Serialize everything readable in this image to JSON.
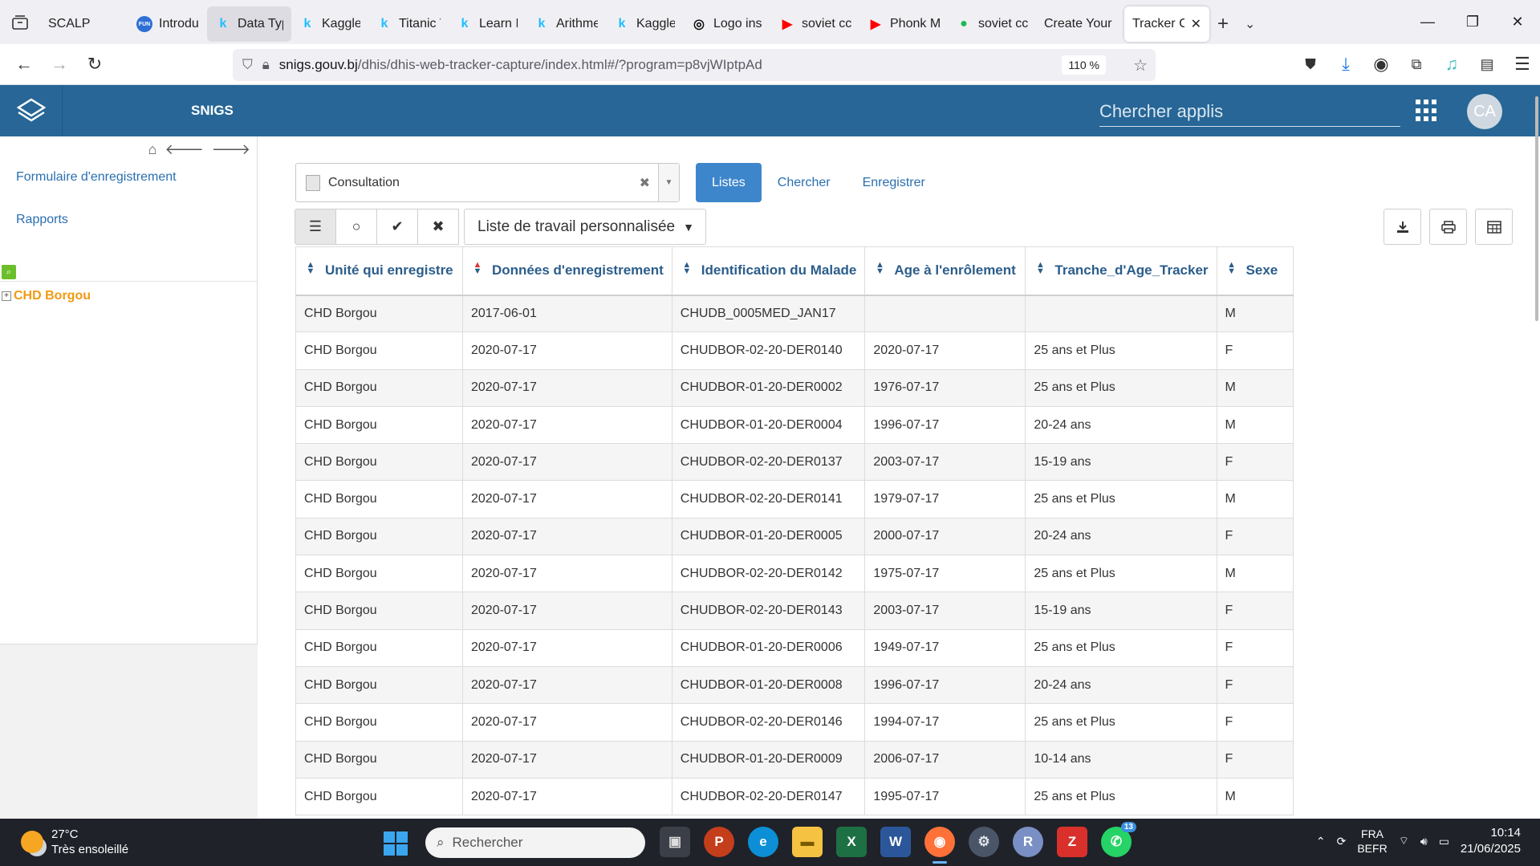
{
  "browser": {
    "tabs": [
      {
        "title": "SCALP",
        "fav": "",
        "favColor": "#888"
      },
      {
        "title": "Introduc",
        "fav": "FUN",
        "favColor": "#2e6fd6"
      },
      {
        "title": "Data Typ",
        "fav": "k",
        "favColor": "#20beff"
      },
      {
        "title": "Kaggle N",
        "fav": "k",
        "favColor": "#20beff"
      },
      {
        "title": "Titanic T",
        "fav": "k",
        "favColor": "#20beff"
      },
      {
        "title": "Learn Int",
        "fav": "k",
        "favColor": "#20beff"
      },
      {
        "title": "Arithmet",
        "fav": "k",
        "favColor": "#20beff"
      },
      {
        "title": "Kaggle N",
        "fav": "k",
        "favColor": "#20beff"
      },
      {
        "title": "Logo ins",
        "fav": "◎",
        "favColor": "#111"
      },
      {
        "title": "soviet cc",
        "fav": "▶",
        "favColor": "#f00"
      },
      {
        "title": "Phonk M",
        "fav": "▶",
        "favColor": "#f00"
      },
      {
        "title": "soviet cc",
        "fav": "●",
        "favColor": "#1db954"
      },
      {
        "title": "Create Your I",
        "fav": "",
        "favColor": "#888"
      },
      {
        "title": "Tracker Ca",
        "fav": "",
        "favColor": "#888"
      }
    ],
    "active_tab_index": 13,
    "url_host": "snigs.gouv.bj",
    "url_path": "/dhis/dhis-web-tracker-capture/index.html#/?program=p8vjWIptpAd",
    "zoom": "110 %"
  },
  "app": {
    "name": "SNIGS",
    "search_placeholder": "Chercher applis",
    "avatar": "CA"
  },
  "sidebar": {
    "links": [
      "Formulaire d'enregistrement",
      "Rapports"
    ],
    "tree_root": "CHD Borgou"
  },
  "main": {
    "program_select": "Consultation",
    "nav_tabs": [
      "Listes",
      "Chercher",
      "Enregistrer"
    ],
    "worklist_label": "Liste de travail personnalisée",
    "table": {
      "headers": [
        "Unité qui enregistre",
        "Données d'enregistrement",
        "Identification du Malade",
        "Age à l'enrôlement",
        "Tranche_d'Age_Tracker",
        "Sexe"
      ],
      "rows": [
        [
          "CHD Borgou",
          "2017-06-01",
          "CHUDB_0005MED_JAN17",
          "",
          "",
          "M"
        ],
        [
          "CHD Borgou",
          "2020-07-17",
          "CHUDBOR-02-20-DER0140",
          "2020-07-17",
          "25 ans et Plus",
          "F"
        ],
        [
          "CHD Borgou",
          "2020-07-17",
          "CHUDBOR-01-20-DER0002",
          "1976-07-17",
          "25 ans et Plus",
          "M"
        ],
        [
          "CHD Borgou",
          "2020-07-17",
          "CHUDBOR-01-20-DER0004",
          "1996-07-17",
          "20-24 ans",
          "M"
        ],
        [
          "CHD Borgou",
          "2020-07-17",
          "CHUDBOR-02-20-DER0137",
          "2003-07-17",
          "15-19 ans",
          "F"
        ],
        [
          "CHD Borgou",
          "2020-07-17",
          "CHUDBOR-02-20-DER0141",
          "1979-07-17",
          "25 ans et Plus",
          "M"
        ],
        [
          "CHD Borgou",
          "2020-07-17",
          "CHUDBOR-01-20-DER0005",
          "2000-07-17",
          "20-24 ans",
          "F"
        ],
        [
          "CHD Borgou",
          "2020-07-17",
          "CHUDBOR-02-20-DER0142",
          "1975-07-17",
          "25 ans et Plus",
          "M"
        ],
        [
          "CHD Borgou",
          "2020-07-17",
          "CHUDBOR-02-20-DER0143",
          "2003-07-17",
          "15-19 ans",
          "F"
        ],
        [
          "CHD Borgou",
          "2020-07-17",
          "CHUDBOR-01-20-DER0006",
          "1949-07-17",
          "25 ans et Plus",
          "F"
        ],
        [
          "CHD Borgou",
          "2020-07-17",
          "CHUDBOR-01-20-DER0008",
          "1996-07-17",
          "20-24 ans",
          "F"
        ],
        [
          "CHD Borgou",
          "2020-07-17",
          "CHUDBOR-02-20-DER0146",
          "1994-07-17",
          "25 ans et Plus",
          "F"
        ],
        [
          "CHD Borgou",
          "2020-07-17",
          "CHUDBOR-01-20-DER0009",
          "2006-07-17",
          "10-14 ans",
          "F"
        ],
        [
          "CHD Borgou",
          "2020-07-17",
          "CHUDBOR-02-20-DER0147",
          "1995-07-17",
          "25 ans et Plus",
          "M"
        ]
      ]
    }
  },
  "taskbar": {
    "temperature": "27°C",
    "weather": "Très ensoleillé",
    "search_placeholder": "Rechercher",
    "lang_top": "FRA",
    "lang_bottom": "BEFR",
    "time": "10:14",
    "date": "21/06/2025",
    "whatsapp_badge": "13"
  },
  "colors": {
    "header_bg": "#276696",
    "active_tab_btn": "#3e86cc",
    "tree_node": "#f19a12",
    "link": "#2a6fb0"
  }
}
